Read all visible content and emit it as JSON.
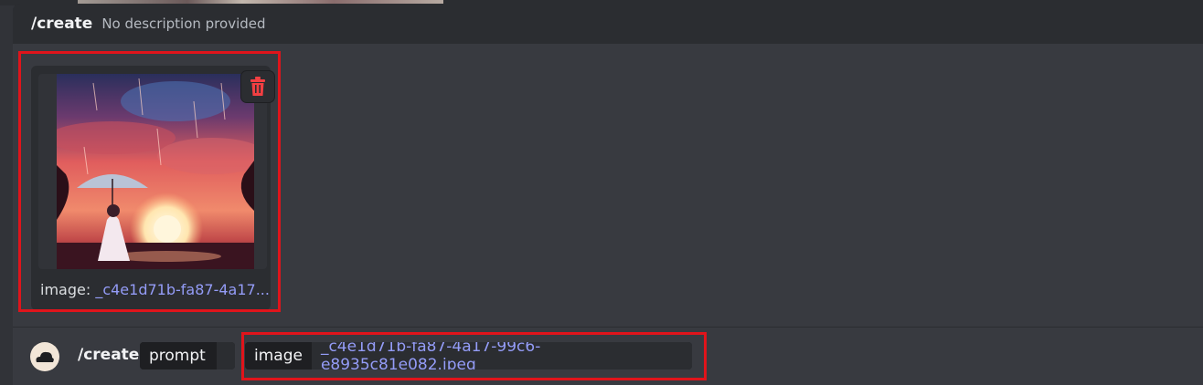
{
  "header": {
    "command": "/create",
    "description": "No description provided"
  },
  "attachment": {
    "caption_label": "image:",
    "caption_value": "_c4e1d71b-fa87-4a17..."
  },
  "bottom_bar": {
    "command": "/create",
    "options": [
      {
        "name": "prompt",
        "value": ""
      },
      {
        "name": "image",
        "value": "_c4e1d71b-fa87-4a17-99c6-e8935c81e082.jpeg"
      }
    ]
  },
  "colors": {
    "highlight": "#e0141b",
    "link": "#949cf7",
    "delete": "#f23f42"
  },
  "icons": {
    "delete": "trash-icon",
    "avatar": "cloud-avatar-icon"
  }
}
